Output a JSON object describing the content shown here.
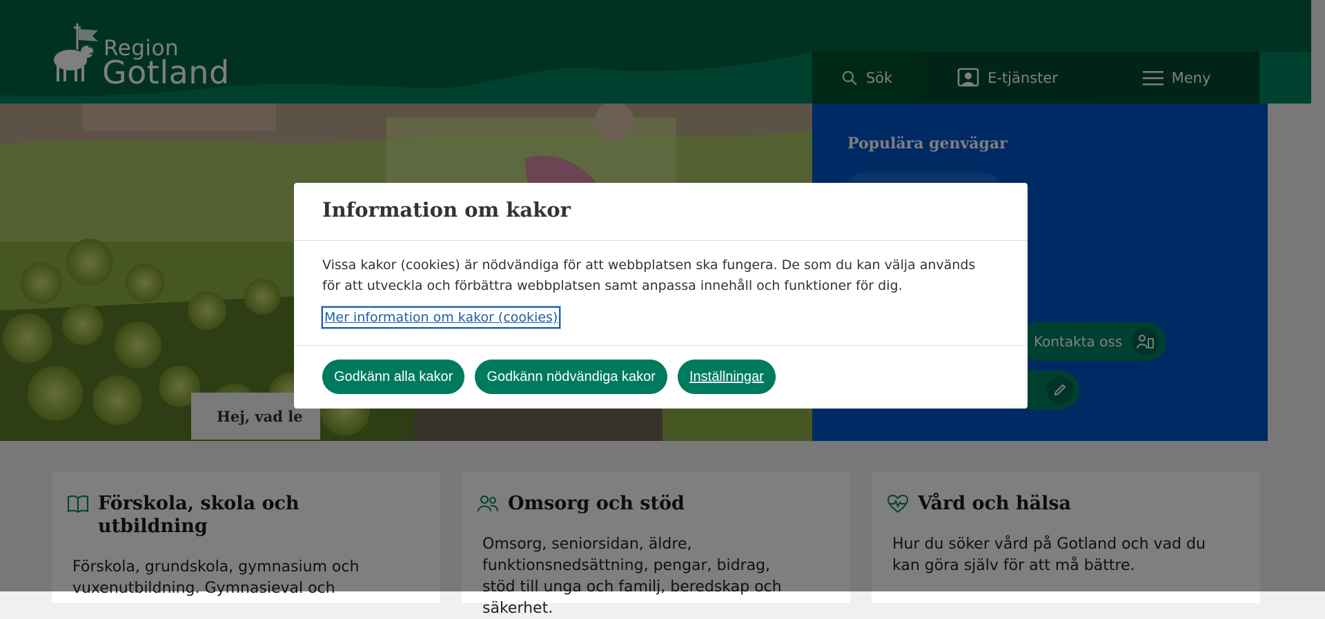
{
  "header": {
    "logo_line1": "Region",
    "logo_line2": "Gotland",
    "nav": {
      "search_label": "Sök",
      "eservices_label": "E-tjänster",
      "menu_label": "Meny"
    }
  },
  "hero": {
    "search_text": "Hej, vad le"
  },
  "shortcuts": {
    "title": "Populära genvägar",
    "contact_label": "Kontakta oss"
  },
  "cards": [
    {
      "title": "Förskola, skola och utbildning",
      "icon": "book-icon",
      "text": "Förskola, grundskola, gymnasium och vuxenutbildning. Gymnasieval och"
    },
    {
      "title": "Omsorg och stöd",
      "icon": "people-icon",
      "text": "Omsorg, seniorsidan, äldre, funktionsnedsättning, pengar, bidrag, stöd till unga och familj, beredskap och säkerhet."
    },
    {
      "title": "Vård och hälsa",
      "icon": "heart-pulse-icon",
      "text": "Hur du söker vård på Gotland och vad du kan göra själv för att må bättre."
    }
  ],
  "cookie_dialog": {
    "title": "Information om kakor",
    "body": "Vissa kakor (cookies) är nödvändiga för att webbplatsen ska fungera. De som du kan välja används för att utveckla och förbättra webbplatsen samt anpassa innehåll och funktioner för dig.",
    "more_link": "Mer information om kakor (cookies)",
    "accept_all": "Godkänn alla kakor",
    "accept_necessary": "Godkänn nödvändiga kakor",
    "settings": "Inställningar"
  },
  "colors": {
    "header_green": "#00815c",
    "button_green": "#007a5f",
    "panel_blue": "#0054c8",
    "link_blue": "#1c5fa8"
  }
}
